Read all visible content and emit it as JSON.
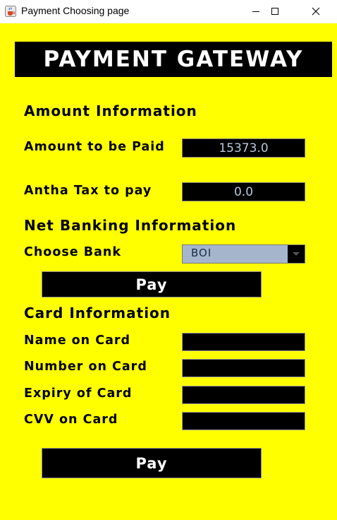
{
  "window": {
    "title": "Payment Choosing page"
  },
  "banner": {
    "title": "PAYMENT GATEWAY"
  },
  "amount_section": {
    "heading": "Amount Information",
    "amount_label": "Amount to be Paid",
    "amount_value": "15373.0",
    "tax_label": "Antha Tax to pay",
    "tax_value": "0.0"
  },
  "net_banking": {
    "heading": "Net Banking Information",
    "bank_label": "Choose Bank",
    "bank_selected": "BOI",
    "pay_label": "Pay"
  },
  "card": {
    "heading": "Card Information",
    "name_label": "Name on Card",
    "name_value": "",
    "number_label": "Number on Card",
    "number_value": "",
    "expiry_label": "Expiry of Card",
    "expiry_value": "",
    "cvv_label": "CVV on Card",
    "cvv_value": "",
    "pay_label": "Pay"
  },
  "colors": {
    "background": "#ffff00",
    "panel": "#000000",
    "field_text": "#b8c7dc",
    "select_bg": "#a5b6cc"
  },
  "icons": {
    "app": "java-cup-icon",
    "minimize": "minimize-icon",
    "maximize": "maximize-icon",
    "close": "close-icon",
    "dropdown": "chevron-down-icon"
  }
}
